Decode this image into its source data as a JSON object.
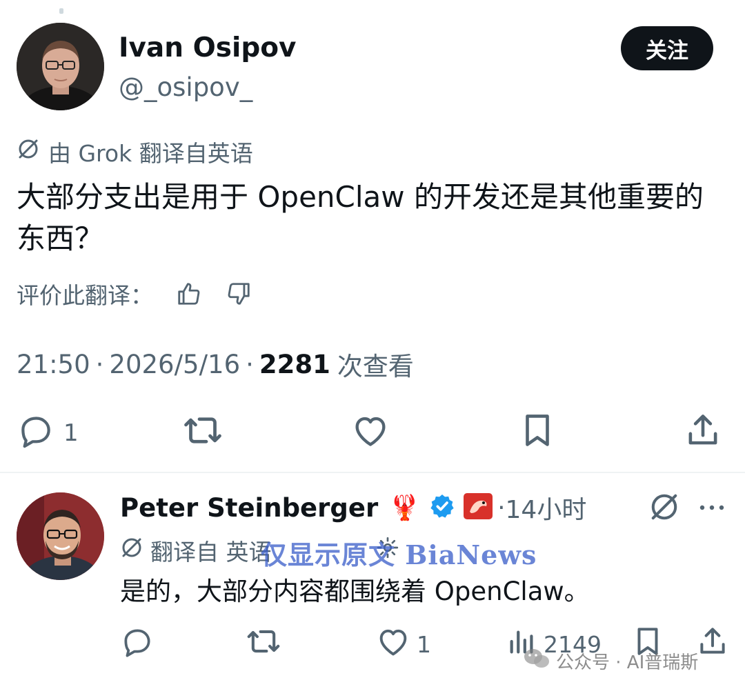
{
  "main_tweet": {
    "name": "Ivan Osipov",
    "handle": "@_osipov_",
    "follow_label": "关注",
    "translated_by": "由 Grok 翻译自英语",
    "text": "大部分支出是用于 OpenClaw 的开发还是其他重要的东西？",
    "rate_label": "评价此翻译：",
    "time": "21:50",
    "date": "2026/5/16",
    "views": "2281",
    "views_label": "次查看",
    "reply_count": "1",
    "icons": [
      "reply-icon",
      "retweet-icon",
      "like-icon",
      "bookmark-icon",
      "share-icon"
    ]
  },
  "reply_tweet": {
    "name": "Peter Steinberger",
    "emoji": "🦞",
    "time": "14小时",
    "translated_label": "翻译自 英语",
    "text": "是的，大部分内容都围绕着 OpenClaw。",
    "like_count": "1",
    "views": "2149"
  },
  "watermarks": {
    "overlay": "仅显示原文 BiaNews",
    "wechat": "公众号 · AI普瑞斯"
  },
  "colors": {
    "text": "#0f1419",
    "secondary": "#536471",
    "verified": "#1d9bf0",
    "follow_bg": "#0f1419"
  }
}
